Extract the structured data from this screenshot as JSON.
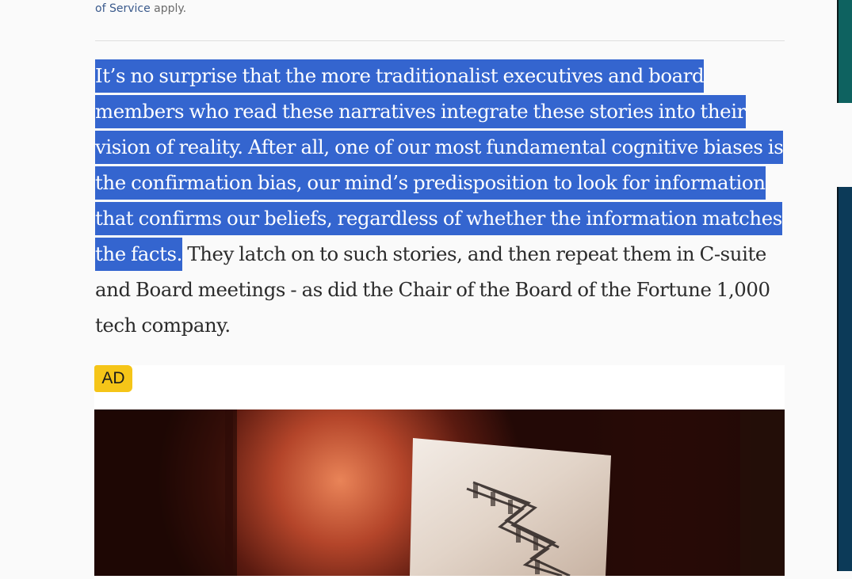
{
  "terms": {
    "link_label": "of Service",
    "suffix": " apply."
  },
  "article": {
    "highlighted_text": "It’s no surprise that the more traditionalist executives and board members who read these narratives integrate these stories into their vision of reality. After all, one of our most fundamental cognitive biases is the confirmation bias, our mind’s predisposition to look for information that confirms our beliefs, regardless of whether the information matches the facts.",
    "rest_text": " They latch on to such stories, and then repeat them in C-suite and Board meetings - as did the Chair of the Board of the Fortune 1,000 tech company."
  },
  "ad": {
    "badge_label": "AD"
  },
  "colors": {
    "selection": "#3465cf",
    "ad_badge": "#f5c518",
    "right_panel_top": "#0e6260",
    "right_panel_bottom": "#0c3a58"
  }
}
